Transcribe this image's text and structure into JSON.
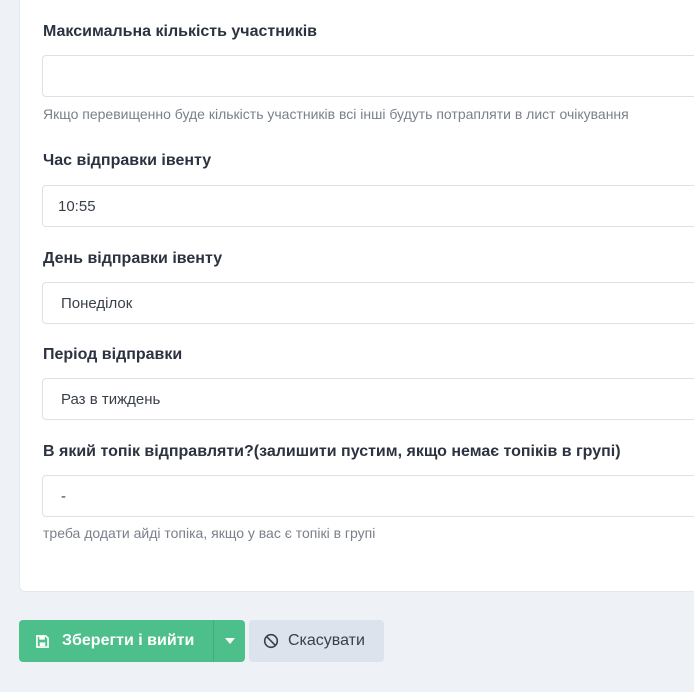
{
  "form": {
    "max_participants": {
      "label": "Максимальна кількість участників",
      "value": "",
      "placeholder": "",
      "help": "Якщо перевищенно буде кількість участників всі інші будуть потрапляти в лист очікування"
    },
    "send_time": {
      "label": "Час відправки івенту",
      "value": "10:55"
    },
    "send_day": {
      "label": "День відправки івенту",
      "value": "Понеділок"
    },
    "send_period": {
      "label": "Період відправки",
      "value": "Раз в тиждень"
    },
    "topic": {
      "label": "В який топік відправляти?(залишити пустим, якщо немає топіків в групі)",
      "value": "-",
      "help": "треба додати айді топіка, якщо у вас є топікі в групі"
    }
  },
  "actions": {
    "save_label": "Зберегти і вийти",
    "cancel_label": "Скасувати",
    "save_icon": "floppy-disk-icon",
    "dropdown_icon": "caret-down-icon",
    "cancel_icon": "ban-icon",
    "save_color": "#4cbf8a",
    "cancel_color": "#dde3ec"
  }
}
